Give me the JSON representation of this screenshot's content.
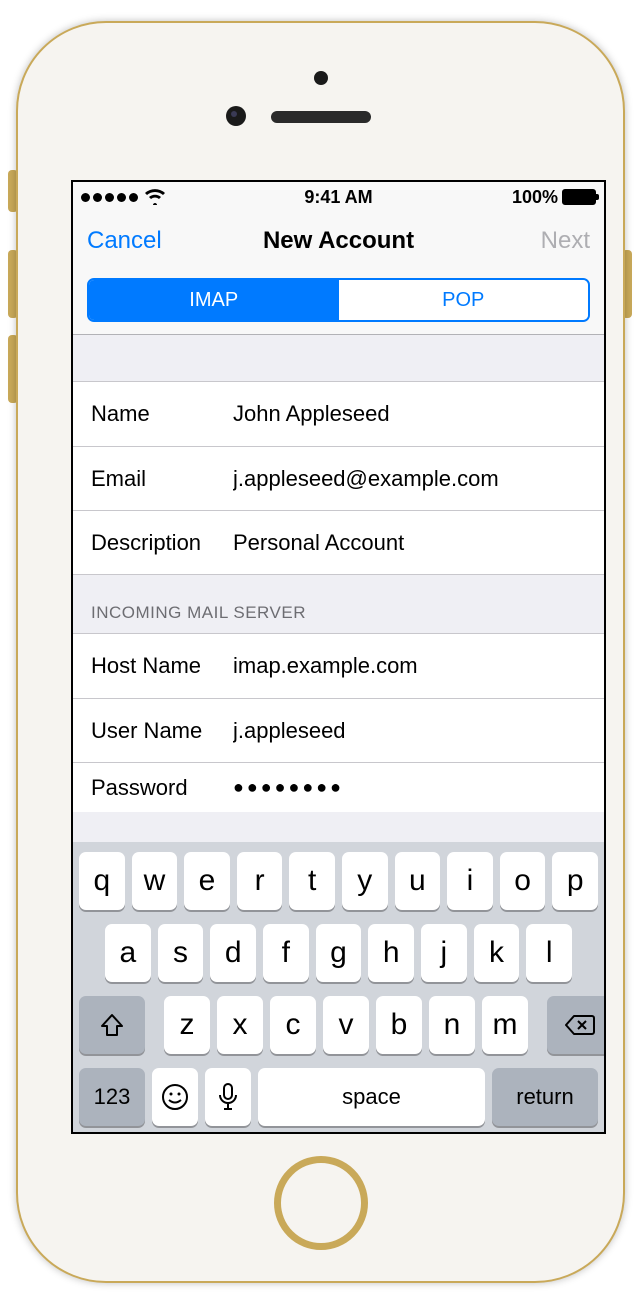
{
  "status": {
    "time": "9:41 AM",
    "battery_pct": "100%"
  },
  "nav": {
    "cancel": "Cancel",
    "title": "New Account",
    "next": "Next"
  },
  "tabs": {
    "imap": "IMAP",
    "pop": "POP"
  },
  "account": {
    "name_label": "Name",
    "name_value": "John Appleseed",
    "email_label": "Email",
    "email_value": "j.appleseed@example.com",
    "description_label": "Description",
    "description_value": "Personal Account"
  },
  "incoming": {
    "header": "INCOMING MAIL SERVER",
    "host_label": "Host Name",
    "host_value": "imap.example.com",
    "user_label": "User Name",
    "user_value": "j.appleseed",
    "password_label": "Password",
    "password_value": "●●●●●●●●"
  },
  "keyboard": {
    "row1": [
      "q",
      "w",
      "e",
      "r",
      "t",
      "y",
      "u",
      "i",
      "o",
      "p"
    ],
    "row2": [
      "a",
      "s",
      "d",
      "f",
      "g",
      "h",
      "j",
      "k",
      "l"
    ],
    "row3": [
      "z",
      "x",
      "c",
      "v",
      "b",
      "n",
      "m"
    ],
    "numbers": "123",
    "space": "space",
    "return": "return"
  }
}
